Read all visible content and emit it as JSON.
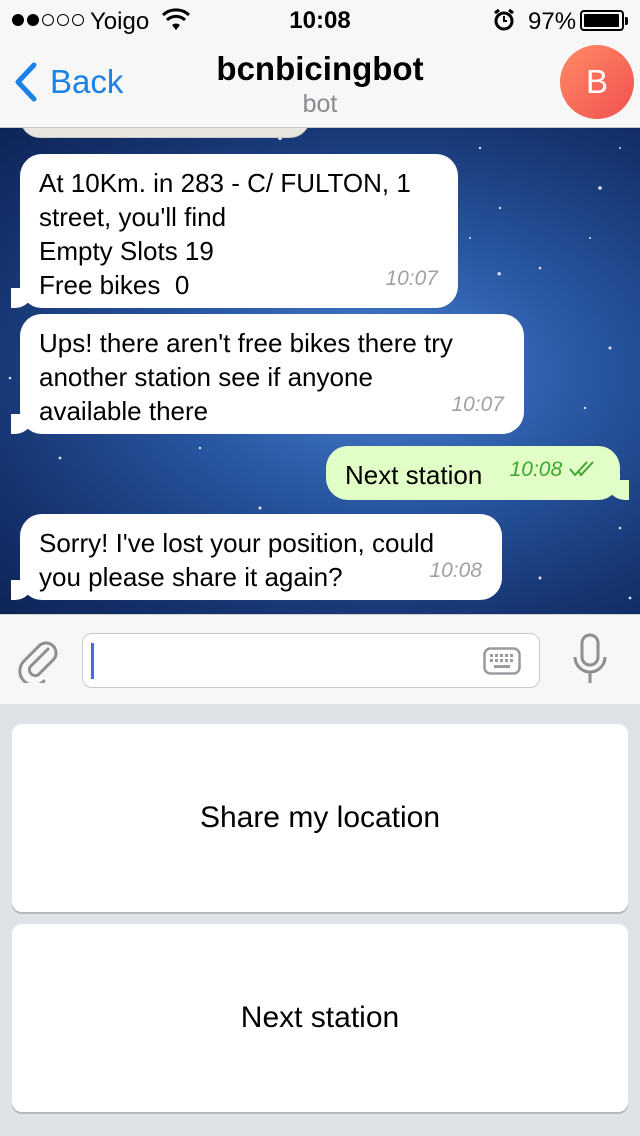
{
  "status_bar": {
    "carrier": "Yoigo",
    "time": "10:08",
    "battery_percent": "97%",
    "signal_bars_filled": 2,
    "signal_bars_total": 5,
    "battery_level": 0.97
  },
  "nav": {
    "back_label": "Back",
    "title": "bcnbicingbot",
    "subtitle": "bot",
    "avatar_letter": "B",
    "avatar_color_start": "#ff8a65",
    "avatar_color_end": "#f25050"
  },
  "messages": [
    {
      "direction": "in",
      "lines": [
        "At 10Km. in 283 - C/ FULTON, 1",
        "street, you'll find",
        "Empty Slots 19",
        "Free bikes  0"
      ],
      "time": "10:07"
    },
    {
      "direction": "in",
      "lines": [
        "Ups! there aren't free bikes there try",
        "another station see if anyone",
        "available there"
      ],
      "time": "10:07"
    },
    {
      "direction": "out",
      "lines": [
        "Next station"
      ],
      "time": "10:08",
      "status": "read"
    },
    {
      "direction": "in",
      "lines": [
        "Sorry! I've lost your position, could",
        "you please share it again?"
      ],
      "time": "10:08"
    }
  ],
  "input": {
    "placeholder": "",
    "value": ""
  },
  "reply_keyboard": [
    {
      "label": "Share my location"
    },
    {
      "label": "Next station"
    }
  ],
  "colors": {
    "accent": "#1a82e6",
    "outgoing_bubble": "#e1fec6",
    "read_checks": "#3fa82f"
  }
}
